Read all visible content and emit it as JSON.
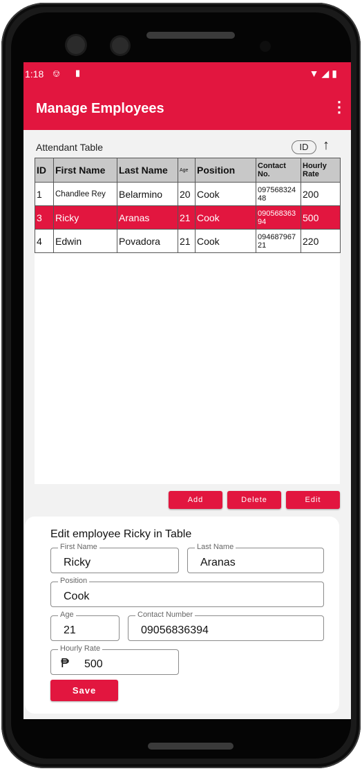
{
  "status_bar": {
    "time": "1:18",
    "left_icons": "⎊ ▮",
    "right_icons": "▼◢▮"
  },
  "app_bar": {
    "title": "Manage Employees",
    "overflow_icon": "⋮"
  },
  "table_section": {
    "caption": "Attendant Table",
    "sort_field": "ID",
    "sort_arrow": "↑"
  },
  "table": {
    "headers": [
      "ID",
      "First Name",
      "Last Name",
      "Age",
      "Position",
      "Contact No.",
      "Hourly Rate"
    ],
    "rows": [
      [
        "1",
        "Chandlee Rey",
        "Belarmino",
        "20",
        "Cook",
        "09756832448",
        "200"
      ],
      [
        "3",
        "Ricky",
        "Aranas",
        "21",
        "Cook",
        "09056836394",
        "500"
      ],
      [
        "4",
        "Edwin",
        "Povadora",
        "21",
        "Cook",
        "09468796721",
        "220"
      ]
    ],
    "selected_row": 1
  },
  "actions": {
    "add": "Add",
    "delete": "Delete",
    "edit": "Edit"
  },
  "edit_form": {
    "title": "Edit employee Ricky in Table",
    "first_name": {
      "label": "First Name",
      "value": "Ricky"
    },
    "last_name": {
      "label": "Last Name",
      "value": "Aranas"
    },
    "position": {
      "label": "Position",
      "value": "Cook"
    },
    "age": {
      "label": "Age",
      "value": "21"
    },
    "contact": {
      "label": "Contact Number",
      "value": "09056836394"
    },
    "hourly_rate": {
      "label": "Hourly Rate",
      "value": "500",
      "currency_symbol": "₱"
    },
    "save": "Save"
  },
  "colors": {
    "accent": "#e2163f",
    "header_bg": "#c8c8c8"
  }
}
